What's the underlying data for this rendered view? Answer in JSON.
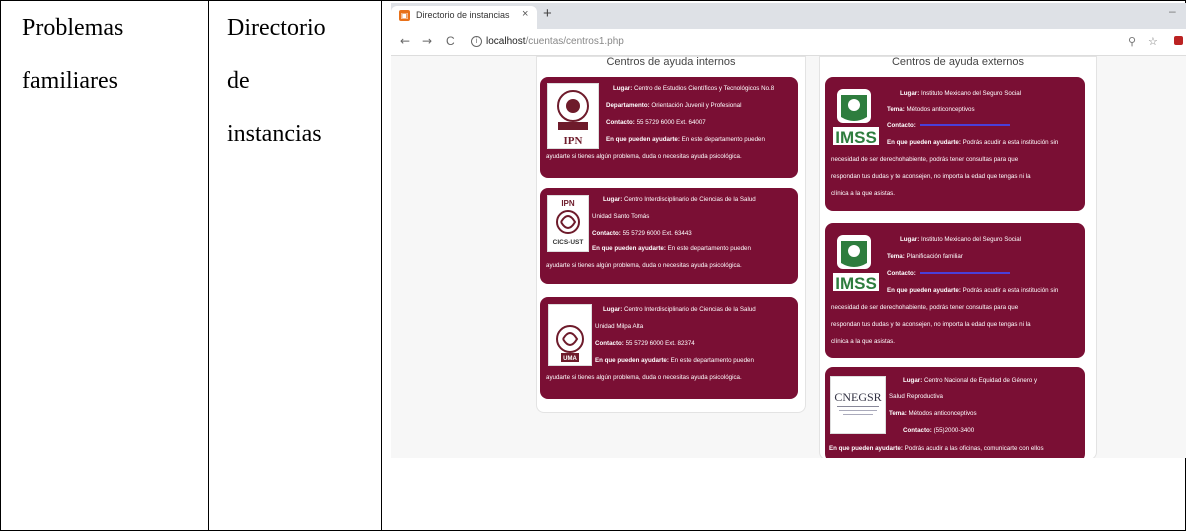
{
  "table": {
    "col1": [
      "Problemas",
      "familiares"
    ],
    "col2": [
      "Directorio",
      "de",
      "instancias"
    ]
  },
  "browser": {
    "tab_title": "Directorio de instancias",
    "tab_close": "×",
    "new_tab": "+",
    "minimize": "–",
    "url_host": "localhost",
    "url_path": "/cuentas/centros1.php",
    "back": "←",
    "forward": "→",
    "reload": "C",
    "info": "i",
    "zoom_icon": "⚲",
    "star_icon": "☆"
  },
  "page": {
    "internal_heading": "Centros de ayuda internos",
    "external_heading": "Centros de ayuda externos",
    "internal_cards": [
      {
        "logo_text": "IPN",
        "lines": [
          {
            "label": "Lugar:",
            "text": " Centro de Estudios Científicos y Tecnológicos No.8"
          },
          {
            "label": "Departamento:",
            "text": " Orientación Juvenil y Profesional"
          },
          {
            "label": "Contacto:",
            "text": " 55 5729 6000 Ext. 64007"
          },
          {
            "label": "En que pueden ayudarte:",
            "text": " En este departamento pueden"
          },
          {
            "label": "",
            "text": "ayudarte si tienes algún problema, duda o necesitas ayuda psicológica."
          }
        ]
      },
      {
        "logo_text": "CICS-UST",
        "logo_top": "IPN",
        "lines": [
          {
            "label": "Lugar:",
            "text": " Centro Interdisciplinario de Ciencias de la Salud"
          },
          {
            "label": "",
            "text": "Unidad Santo Tomás"
          },
          {
            "label": "Contacto:",
            "text": " 55 5729 6000 Ext. 63443"
          },
          {
            "label": "En que pueden ayudarte:",
            "text": " En este departamento pueden"
          },
          {
            "label": "",
            "text": "ayudarte si tienes algún problema, duda o necesitas ayuda psicológica."
          }
        ]
      },
      {
        "logo_text": "UMA",
        "lines": [
          {
            "label": "Lugar:",
            "text": " Centro Interdisciplinario de Ciencias de la Salud"
          },
          {
            "label": "",
            "text": "Unidad Milpa Alta"
          },
          {
            "label": "Contacto:",
            "text": " 55 5729 6000 Ext. 82374"
          },
          {
            "label": "En que pueden ayudarte:",
            "text": " En este departamento pueden"
          },
          {
            "label": "",
            "text": "ayudarte si tienes algún problema, duda o necesitas ayuda psicológica."
          }
        ]
      }
    ],
    "external_cards": [
      {
        "logo_text": "IMSS",
        "lines": [
          {
            "label": "Lugar:",
            "text": " Instituto Mexicano del Seguro Social"
          },
          {
            "label": "Tema:",
            "text": " Métodos anticonceptivos"
          },
          {
            "label": "Contacto:",
            "text": ""
          },
          {
            "label": "En que pueden ayudarte:",
            "text": " Podrás acudir a esta institución sin"
          },
          {
            "label": "",
            "text": "necesidad de ser derechohabiente, podrás tener consultas para que"
          },
          {
            "label": "",
            "text": "respondan tus dudas y te aconsejen, no importa la edad que tengas ni la"
          },
          {
            "label": "",
            "text": "clínica a la que asistas."
          }
        ]
      },
      {
        "logo_text": "IMSS",
        "lines": [
          {
            "label": "Lugar:",
            "text": " Instituto Mexicano del Seguro Social"
          },
          {
            "label": "Tema:",
            "text": " Planificación familiar"
          },
          {
            "label": "Contacto:",
            "text": ""
          },
          {
            "label": "En que pueden ayudarte:",
            "text": " Podrás acudir a esta institución sin"
          },
          {
            "label": "",
            "text": "necesidad de ser derechohabiente, podrás tener consultas para que"
          },
          {
            "label": "",
            "text": "respondan tus dudas y te aconsejen, no importa la edad que tengas ni la"
          },
          {
            "label": "",
            "text": "clínica a la que asistas."
          }
        ]
      },
      {
        "logo_text": "CNEGSR",
        "lines": [
          {
            "label": "Lugar:",
            "text": " Centro Nacional de Equidad de Género y"
          },
          {
            "label": "",
            "text": "Salud Reproductiva"
          },
          {
            "label": "Tema:",
            "text": " Métodos anticonceptivos"
          },
          {
            "label": "Contacto:",
            "text": " (55)2000-3400"
          },
          {
            "label": "En que pueden ayudarte:",
            "text": " Podrás acudir a las oficinas, comunicarte con ellos"
          }
        ]
      }
    ]
  },
  "colors": {
    "card": "#7a0f34",
    "imss_green": "#2e7d3e",
    "ipn_maroon": "#6e1b2b"
  }
}
